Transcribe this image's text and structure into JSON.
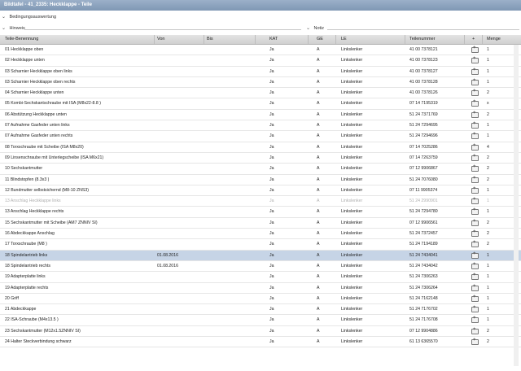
{
  "window": {
    "title": "Bildtafel - 41_2335: Heckklappe - Teile"
  },
  "sections": {
    "bedingung": "Bedingungsauswertung",
    "hinweis": "Hinweis",
    "notiz": "Notiz"
  },
  "table": {
    "headers": {
      "name": "Teile-Benennung",
      "von": "Von",
      "bis": "Bis",
      "kat": "KAT",
      "ge": "GE",
      "le": "LE",
      "nummer": "Teilenummer",
      "plus": "+",
      "menge": "Menge"
    },
    "rows": [
      {
        "name": "01 Heckklappe oben",
        "von": "",
        "bis": "",
        "kat": "Ja",
        "ge": "A",
        "le": "Linkslenker",
        "nummer": "41 00 7378121",
        "menge": "1"
      },
      {
        "name": "02 Heckklappe unten",
        "von": "",
        "bis": "",
        "kat": "Ja",
        "ge": "A",
        "le": "Linkslenker",
        "nummer": "41 00 7378123",
        "menge": "1"
      },
      {
        "name": "03 Scharnier Heckklappe oben links",
        "von": "",
        "bis": "",
        "kat": "Ja",
        "ge": "A",
        "le": "Linkslenker",
        "nummer": "41 00 7378127",
        "menge": "1"
      },
      {
        "name": "03 Scharnier Heckklappe oben rechts",
        "von": "",
        "bis": "",
        "kat": "Ja",
        "ge": "A",
        "le": "Linkslenker",
        "nummer": "41 00 7378128",
        "menge": "1"
      },
      {
        "name": "04 Scharnier Heckklappe unten",
        "von": "",
        "bis": "",
        "kat": "Ja",
        "ge": "A",
        "le": "Linkslenker",
        "nummer": "41 00 7378126",
        "menge": "2"
      },
      {
        "name": "05 Kombi-Sechskantschraube mit ISA (M8x22-8.8 )",
        "von": "",
        "bis": "",
        "kat": "Ja",
        "ge": "A",
        "le": "Linkslenker",
        "nummer": "07 14 7195319",
        "menge": "x"
      },
      {
        "name": "06 Abstützung Heckklappe unten",
        "von": "",
        "bis": "",
        "kat": "Ja",
        "ge": "A",
        "le": "Linkslenker",
        "nummer": "51 24 7371769",
        "menge": "2"
      },
      {
        "name": "07 Aufnahme Gasfeder unten links",
        "von": "",
        "bis": "",
        "kat": "Ja",
        "ge": "A",
        "le": "Linkslenker",
        "nummer": "51 24 7294695",
        "menge": "1"
      },
      {
        "name": "07 Aufnahme Gasfeder unten rechts",
        "von": "",
        "bis": "",
        "kat": "Ja",
        "ge": "A",
        "le": "Linkslenker",
        "nummer": "51 24 7294696",
        "menge": "1"
      },
      {
        "name": "08 Torxschraube mit Scheibe (ISA M8x20)",
        "von": "",
        "bis": "",
        "kat": "Ja",
        "ge": "A",
        "le": "Linkslenker",
        "nummer": "07 14 7025286",
        "menge": "4"
      },
      {
        "name": "09 Linsenschraube mit Unterlegscheibe (ISA M6x21)",
        "von": "",
        "bis": "",
        "kat": "Ja",
        "ge": "A",
        "le": "Linkslenker",
        "nummer": "07 14 7263759",
        "menge": "2"
      },
      {
        "name": "10 Sechskantmutter",
        "von": "",
        "bis": "",
        "kat": "Ja",
        "ge": "A",
        "le": "Linkslenker",
        "nummer": "07 12 9906867",
        "menge": "2"
      },
      {
        "name": "11 Blindstopfen (8.3x3 )",
        "von": "",
        "bis": "",
        "kat": "Ja",
        "ge": "A",
        "le": "Linkslenker",
        "nummer": "51 24 7076080",
        "menge": "2"
      },
      {
        "name": "12 Bundmutter selbstsichernd (M8-10 ZNS3)",
        "von": "",
        "bis": "",
        "kat": "Ja",
        "ge": "A",
        "le": "Linkslenker",
        "nummer": "07 11 9905374",
        "menge": "1"
      },
      {
        "name": "13 Anschlag Heckklappe links",
        "von": "",
        "bis": "",
        "kat": "Ja",
        "ge": "A",
        "le": "Linkslenker",
        "nummer": "51 24 2990901",
        "menge": "1",
        "dim": true
      },
      {
        "name": "13 Anschlag Heckklappe rechts",
        "von": "",
        "bis": "",
        "kat": "Ja",
        "ge": "A",
        "le": "Linkslenker",
        "nummer": "51 24 7294780",
        "menge": "1"
      },
      {
        "name": "15 Sechskantmutter mit Scheibe (AM7 ZNNIV SI)",
        "von": "",
        "bis": "",
        "kat": "Ja",
        "ge": "A",
        "le": "Linkslenker",
        "nummer": "07 12 9906561",
        "menge": "2"
      },
      {
        "name": "16 Abdeckkappe Anschlag",
        "von": "",
        "bis": "",
        "kat": "Ja",
        "ge": "A",
        "le": "Linkslenker",
        "nummer": "51 24 7372457",
        "menge": "2"
      },
      {
        "name": "17 Torxschraube (M8 )",
        "von": "",
        "bis": "",
        "kat": "Ja",
        "ge": "A",
        "le": "Linkslenker",
        "nummer": "51 24 7194189",
        "menge": "2"
      },
      {
        "name": "18 Spindelantrieb links",
        "von": "01.08.2016",
        "bis": "",
        "kat": "Ja",
        "ge": "A",
        "le": "Linkslenker",
        "nummer": "51 24 7434041",
        "menge": "1",
        "sel": true
      },
      {
        "name": "18 Spindelantrieb rechts",
        "von": "01.08.2016",
        "bis": "",
        "kat": "Ja",
        "ge": "A",
        "le": "Linkslenker",
        "nummer": "51 24 7434042",
        "menge": "1"
      },
      {
        "name": "19 Adapterplatte links",
        "von": "",
        "bis": "",
        "kat": "Ja",
        "ge": "A",
        "le": "Linkslenker",
        "nummer": "51 24 7306263",
        "menge": "1"
      },
      {
        "name": "19 Adapterplatte rechts",
        "von": "",
        "bis": "",
        "kat": "Ja",
        "ge": "A",
        "le": "Linkslenker",
        "nummer": "51 24 7306264",
        "menge": "1"
      },
      {
        "name": "20 Griff",
        "von": "",
        "bis": "",
        "kat": "Ja",
        "ge": "A",
        "le": "Linkslenker",
        "nummer": "51 24 7162148",
        "menge": "1"
      },
      {
        "name": "21 Abdeckkappe",
        "von": "",
        "bis": "",
        "kat": "Ja",
        "ge": "A",
        "le": "Linkslenker",
        "nummer": "51 24 7176702",
        "menge": "1"
      },
      {
        "name": "22 ISA-Schraube (M4x13.5 )",
        "von": "",
        "bis": "",
        "kat": "Ja",
        "ge": "A",
        "le": "Linkslenker",
        "nummer": "51 24 7176708",
        "menge": "1"
      },
      {
        "name": "23 Sechskantmutter (M12x1.5ZNNIV SI)",
        "von": "",
        "bis": "",
        "kat": "Ja",
        "ge": "A",
        "le": "Linkslenker",
        "nummer": "07 12 9904886",
        "menge": "2"
      },
      {
        "name": "24 Halter Steckverbindung schwarz",
        "von": "",
        "bis": "",
        "kat": "Ja",
        "ge": "A",
        "le": "Linkslenker",
        "nummer": "61 13 6365570",
        "menge": "2"
      }
    ]
  },
  "icons": {
    "expand": "chevron-down-icon",
    "add": "add-to-cart-icon"
  },
  "colors": {
    "titlebar": "#8aa1bd",
    "selected_row": "#c6d4e6",
    "header": "#d9d9d9"
  }
}
